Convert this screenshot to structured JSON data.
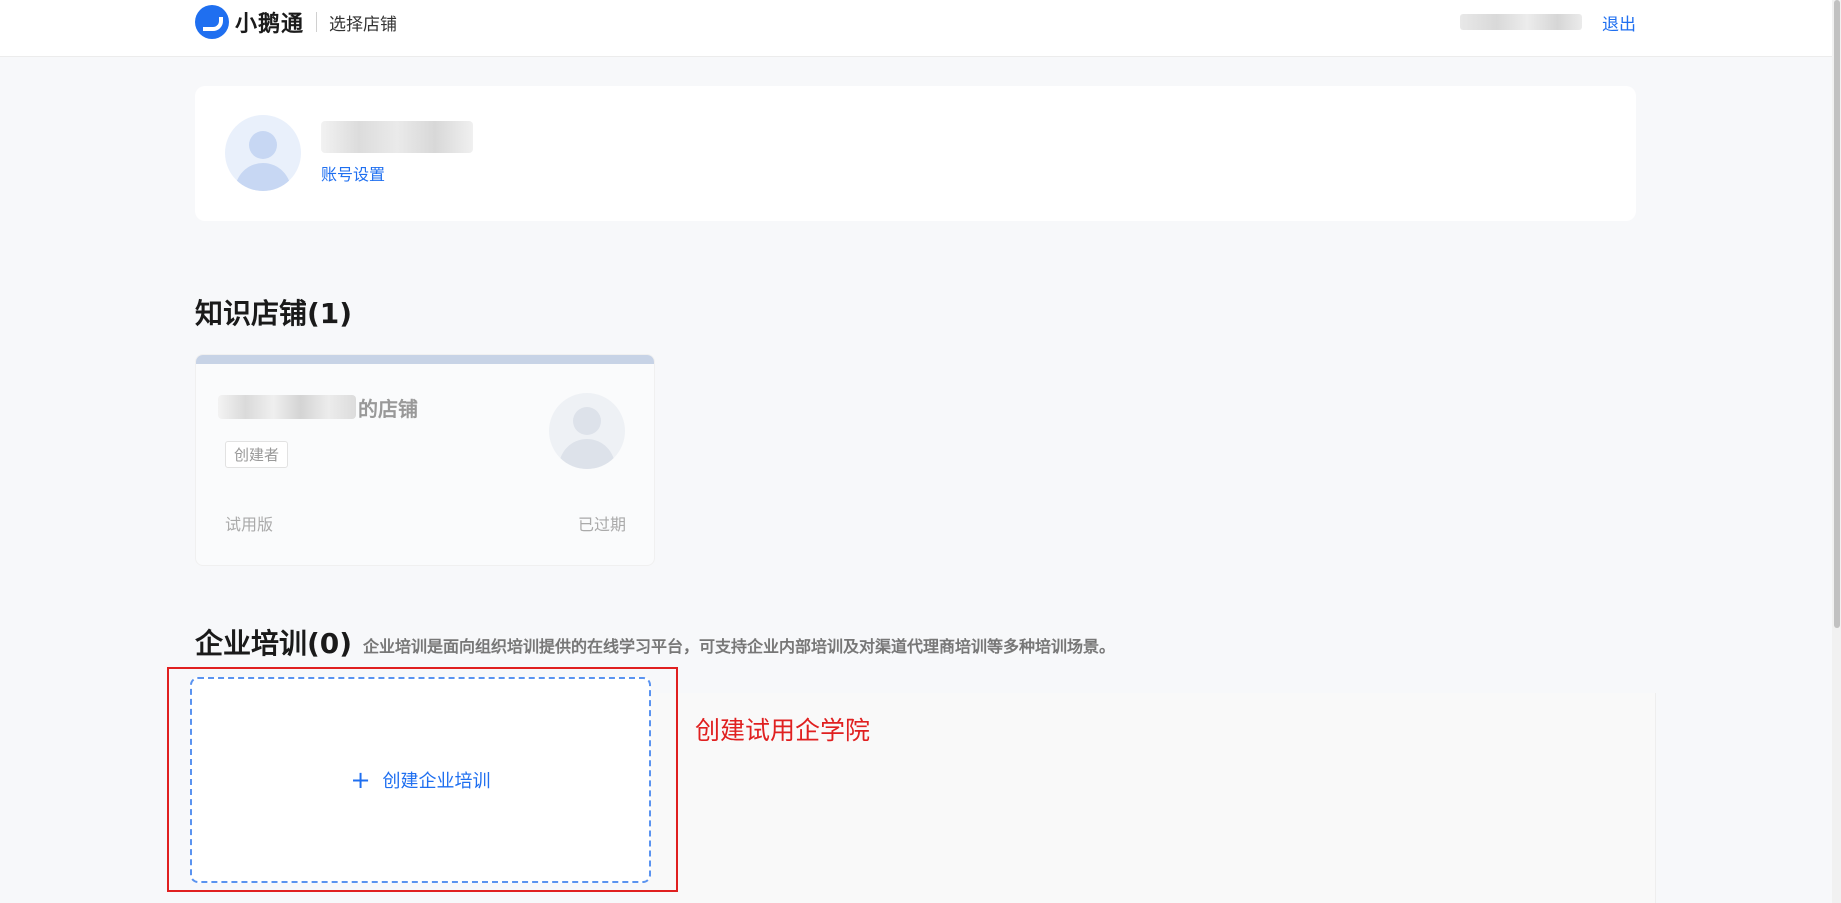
{
  "header": {
    "logo_text": "小鹅通",
    "page_title": "选择店铺",
    "logout_label": "退出"
  },
  "profile": {
    "account_settings_label": "账号设置"
  },
  "knowledge_shops": {
    "title": "知识店铺(1)",
    "items": [
      {
        "name_suffix": "的店铺",
        "role_tag": "创建者",
        "plan": "试用版",
        "status": "已过期"
      }
    ]
  },
  "enterprise_training": {
    "title": "企业培训(0)",
    "description": "企业培训是面向组织培训提供的在线学习平台，可支持企业内部培训及对渠道代理商培训等多种培训场景。",
    "create_label": "创建企业培训",
    "plus_symbol": "+"
  },
  "annotation": {
    "text": "创建试用企学院",
    "color": "#e02020"
  },
  "colors": {
    "accent": "#1f6ff0",
    "background": "#f7f8fa"
  }
}
